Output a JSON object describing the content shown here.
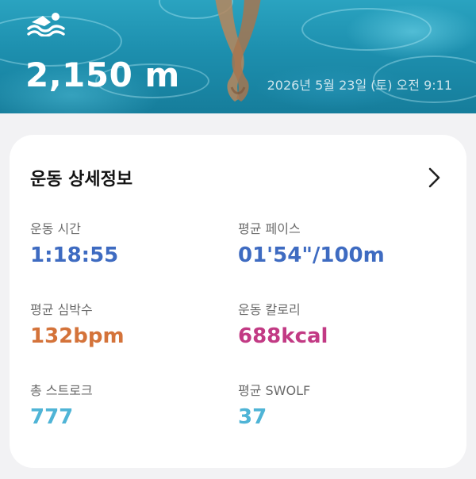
{
  "header": {
    "distance": "2,150 m",
    "datetime": "2026년 5월 23일 (토) 오전 9:11",
    "activity_icon": "swimming-icon"
  },
  "details": {
    "title": "운동 상세정보",
    "chevron_icon": "chevron-right-icon",
    "metrics": [
      {
        "label": "운동 시간",
        "value": "1:18:55",
        "unit": "",
        "color": "#3e6bc1"
      },
      {
        "label": "평균 페이스",
        "value": "01'54\"/100m",
        "unit": "",
        "color": "#3e6bc1"
      },
      {
        "label": "평균 심박수",
        "value": "132",
        "unit": "bpm",
        "color": "#d4733a"
      },
      {
        "label": "운동 칼로리",
        "value": "688",
        "unit": "kcal",
        "color": "#c23a84"
      },
      {
        "label": "총 스트로크",
        "value": "777",
        "unit": "",
        "color": "#4fb4d6"
      },
      {
        "label": "평균 SWOLF",
        "value": "37",
        "unit": "",
        "color": "#4fb4d6"
      }
    ]
  }
}
